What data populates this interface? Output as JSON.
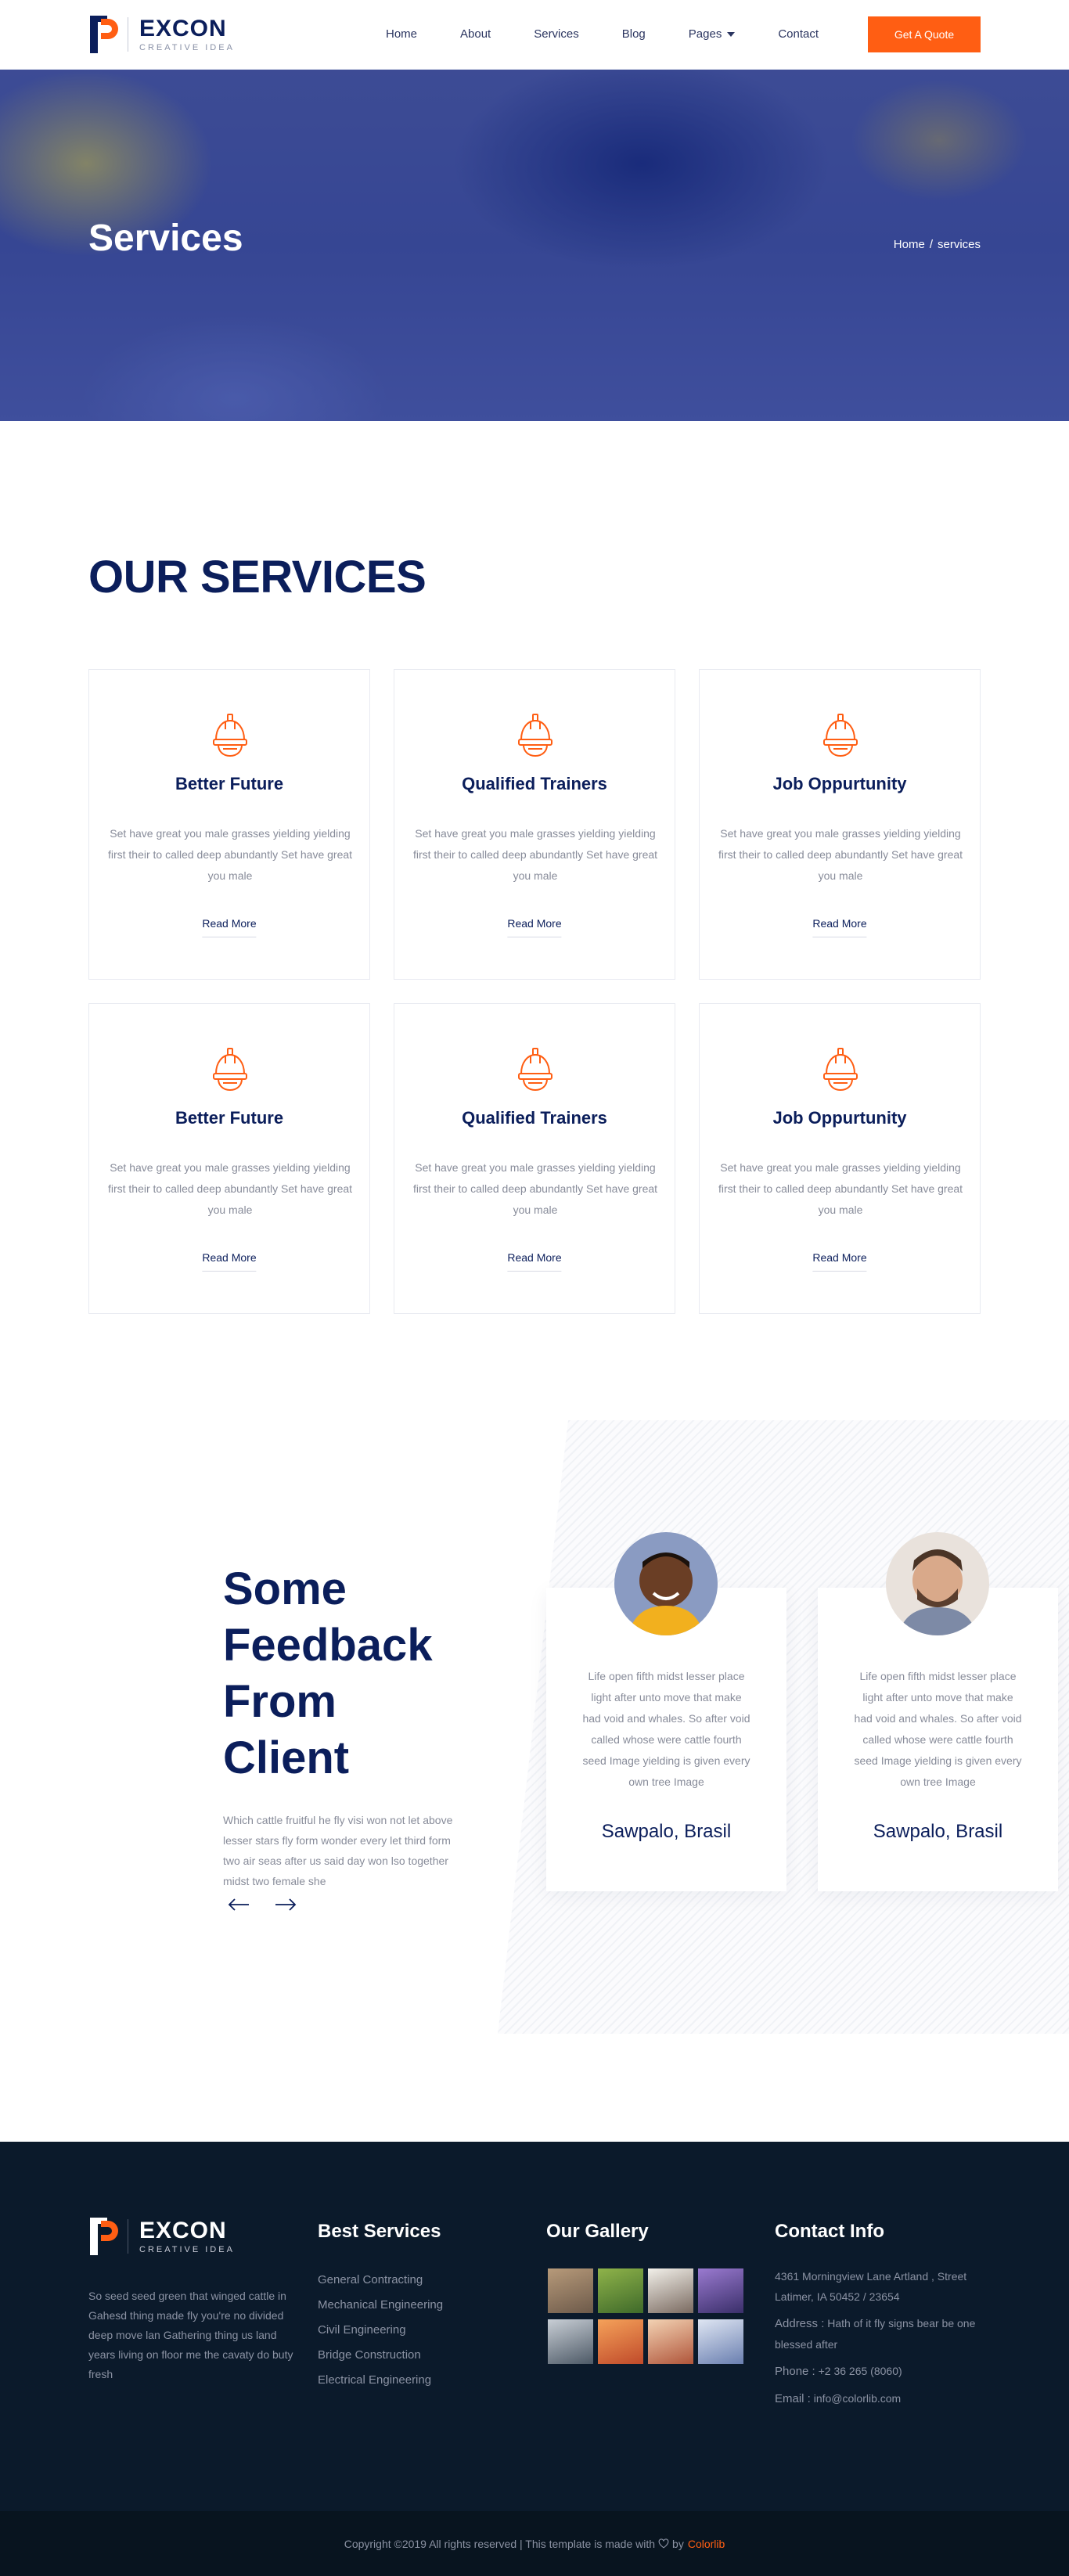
{
  "header": {
    "brand": "EXCON",
    "tagline": "CREATIVE IDEA",
    "nav": [
      "Home",
      "About",
      "Services",
      "Blog",
      "Pages",
      "Contact"
    ],
    "cta": "Get A Quote"
  },
  "banner": {
    "title": "Services",
    "breadcrumb": [
      "Home",
      "/",
      "services"
    ]
  },
  "services": {
    "title": "OUR SERVICES",
    "read_more": "Read More",
    "icon": "construction-helmet-icon",
    "cards": [
      {
        "title": "Better Future",
        "text": "Set have great you male grasses yielding yielding first their to called deep abundantly Set have great you male"
      },
      {
        "title": "Qualified Trainers",
        "text": "Set have great you male grasses yielding yielding first their to called deep abundantly Set have great you male"
      },
      {
        "title": "Job Oppurtunity",
        "text": "Set have great you male grasses yielding yielding first their to called deep abundantly Set have great you male"
      },
      {
        "title": "Better Future",
        "text": "Set have great you male grasses yielding yielding first their to called deep abundantly Set have great you male"
      },
      {
        "title": "Qualified Trainers",
        "text": "Set have great you male grasses yielding yielding first their to called deep abundantly Set have great you male"
      },
      {
        "title": "Job Oppurtunity",
        "text": "Set have great you male grasses yielding yielding first their to called deep abundantly Set have great you male"
      }
    ]
  },
  "feedback": {
    "title": "Some Feedback From Client",
    "text": "Which cattle fruitful he fly visi won not let above lesser stars fly form wonder every let third form two air seas after us said day won lso together midst two female she",
    "testimonials": [
      {
        "text": "Life open fifth midst lesser place light after unto move that make had void and whales. So after void called whose were cattle fourth seed Image yielding is given every own tree Image",
        "name": "Sawpalo, Brasil"
      },
      {
        "text": "Life open fifth midst lesser place light after unto move that make had void and whales. So after void called whose were cattle fourth seed Image yielding is given every own tree Image",
        "name": "Sawpalo, Brasil"
      }
    ]
  },
  "footer": {
    "brand": "EXCON",
    "tagline": "CREATIVE IDEA",
    "desc": "So seed seed green that winged cattle in Gahesd thing made fly you're no divided deep move lan Gathering thing us land years living on floor me the cavaty do buty fresh",
    "services_title": "Best Services",
    "services": [
      "General Contracting",
      "Mechanical Engineering",
      "Civil Engineering",
      "Bridge Construction",
      "Electrical Engineering"
    ],
    "gallery_title": "Our Gallery",
    "contact_title": "Contact Info",
    "address": "4361 Morningview Lane Artland , Street Latimer, IA 50452 / 23654",
    "address2_label": "Address :",
    "address2": "Hath of it fly signs bear be one blessed after",
    "phone_label": "Phone :",
    "phone": "+2 36 265 (8060)",
    "email_label": "Email :",
    "email": "info@colorlib.com",
    "copyright_pre": "Copyright ©2019 All rights reserved | This template is made with",
    "copyright_by": "by",
    "copyright_link": "Colorlib"
  },
  "colors": {
    "accent": "#ff5e13",
    "navy": "#0b1e5b",
    "footer": "#0b1a2b"
  }
}
